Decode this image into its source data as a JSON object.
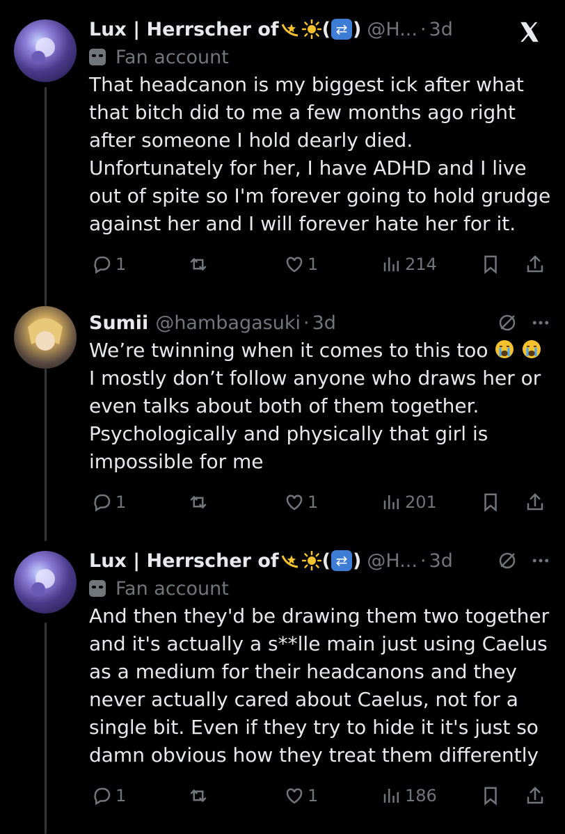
{
  "tweets": [
    {
      "name": "Lux | Herrscher of",
      "name_paren_open": "(",
      "name_paren_close": ")",
      "handle": "@H...",
      "time": "3d",
      "label": "Fan account",
      "text": "That headcanon is my biggest ick after what that bitch did to me a few months ago right after someone I hold dearly died. Unfortunately for her, I have ADHD and I live out of spite so I'm forever going to hold grudge against her and I will forever hate her for it.",
      "replies": "1",
      "likes": "1",
      "views": "214"
    },
    {
      "name": "Sumii",
      "handle": "@hambagasuki",
      "time": "3d",
      "text_part1": "We’re twinning when it comes to this too",
      "text_part2": "I mostly don’t follow anyone who draws her or even talks about both of them together. Psychologically and physically that girl is impossible for me",
      "replies": "1",
      "likes": "1",
      "views": "201"
    },
    {
      "name": "Lux | Herrscher of",
      "name_paren_open": "(",
      "name_paren_close": ")",
      "handle": "@H...",
      "time": "3d",
      "label": "Fan account",
      "text": "And then they'd be drawing them two together and it's actually a s**lle main just using Caelus as a medium for their headcanons and they never actually cared about Caelus, not for a single bit. Even if they try to hide it it's just so damn obvious how they treat them differently",
      "replies": "1",
      "likes": "1",
      "views": "186"
    }
  ],
  "separator": "·",
  "colors": {
    "background": "#000000",
    "text": "#e7e9ea",
    "muted": "#71767b",
    "thread_line": "#333639"
  },
  "icons": [
    "x-logo-icon",
    "more-icon",
    "grok-slash-icon",
    "reply-icon",
    "repost-icon",
    "like-icon",
    "views-icon",
    "bookmark-icon",
    "share-icon",
    "fan-account-icon",
    "dizzy-comet-emoji",
    "sun-emoji",
    "repeat-emoji",
    "crying-emoji"
  ]
}
